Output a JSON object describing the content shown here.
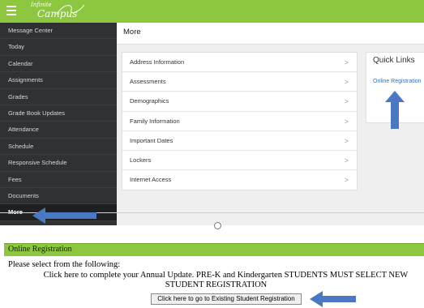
{
  "app": {
    "logo_small": "Infinite",
    "logo_large": "Campus"
  },
  "sidebar": {
    "items": [
      {
        "label": "Message Center"
      },
      {
        "label": "Today"
      },
      {
        "label": "Calendar"
      },
      {
        "label": "Assignments"
      },
      {
        "label": "Grades"
      },
      {
        "label": "Grade Book Updates"
      },
      {
        "label": "Attendance"
      },
      {
        "label": "Schedule"
      },
      {
        "label": "Responsive Schedule"
      },
      {
        "label": "Fees"
      },
      {
        "label": "Documents"
      },
      {
        "label": "More"
      }
    ],
    "active": "More"
  },
  "main": {
    "title": "More",
    "list": [
      {
        "label": "Address Information"
      },
      {
        "label": "Assessments"
      },
      {
        "label": "Demographics"
      },
      {
        "label": "Family Information"
      },
      {
        "label": "Important Dates"
      },
      {
        "label": "Lockers"
      },
      {
        "label": "Internet Access"
      }
    ],
    "chevron": ">"
  },
  "quick_links": {
    "title": "Quick Links",
    "link": "Online Registration"
  },
  "registration": {
    "title": "Online Registration",
    "prompt": "Please select from the following:",
    "instruction_lead": "Click here to complete your Annual Update.",
    "instruction_rest": "PRE-K and Kindergarten STUDENTS MUST SELECT NEW STUDENT REGISTRATION",
    "button": "Click here to go to Existing Student Registration"
  },
  "colors": {
    "brand_green": "#8dc63f",
    "sidebar_bg": "#303133",
    "annotation_arrow": "#4a78c2",
    "link_blue": "#2a73c8"
  }
}
